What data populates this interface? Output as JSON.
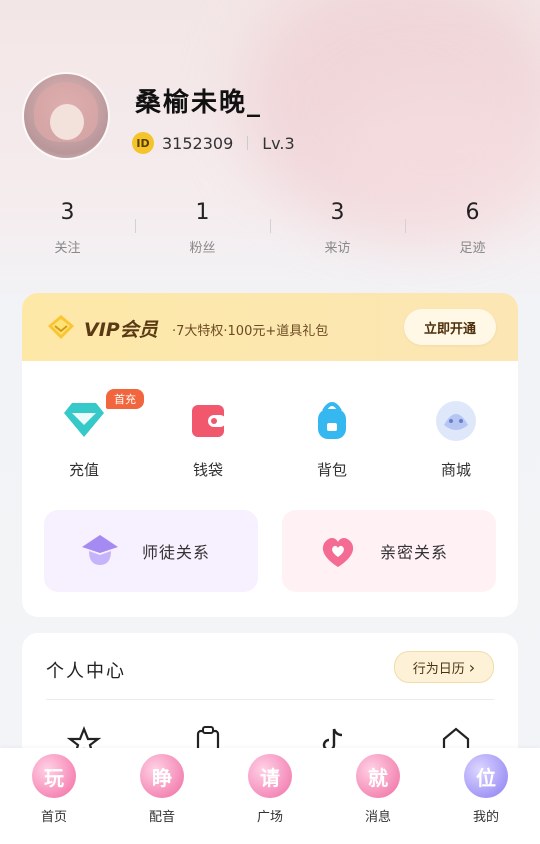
{
  "profile": {
    "username": "桑榆未晚_",
    "id_badge": "ID",
    "id_value": "3152309",
    "level": "Lv.3"
  },
  "stats": [
    {
      "value": "3",
      "label": "关注"
    },
    {
      "value": "1",
      "label": "粉丝"
    },
    {
      "value": "3",
      "label": "来访"
    },
    {
      "value": "6",
      "label": "足迹"
    }
  ],
  "vip": {
    "title": "VIP会员",
    "desc": "·7大特权·100元+道具礼包",
    "button": "立即开通"
  },
  "features": [
    {
      "label": "充值",
      "icon": "diamond-icon",
      "color": "#36c9c9"
    },
    {
      "label": "钱袋",
      "icon": "wallet-icon",
      "color": "#f1576d"
    },
    {
      "label": "背包",
      "icon": "backpack-icon",
      "color": "#35b7f0"
    },
    {
      "label": "商城",
      "icon": "mall-icon",
      "color": "#9fb6f2"
    }
  ],
  "first_tag": "首充",
  "relations": [
    {
      "label": "师徒关系",
      "icon": "mentor-hat-icon",
      "bg": "#f7f1ff"
    },
    {
      "label": "亲密关系",
      "icon": "heart-icon",
      "bg": "#fff1f4"
    }
  ],
  "personal": {
    "title": "个人中心",
    "button": "行为日历",
    "button_arrow": "›"
  },
  "nav": [
    {
      "label": "首页",
      "glyph": "玩",
      "color": "#f26aa1"
    },
    {
      "label": "配音",
      "glyph": "睁",
      "color": "#ef6aa0"
    },
    {
      "label": "广场",
      "glyph": "请",
      "color": "#f06ea7"
    },
    {
      "label": "消息",
      "glyph": "就",
      "color": "#ef6a9f"
    },
    {
      "label": "我的",
      "glyph": "位",
      "color": "#8a7cf2"
    }
  ]
}
